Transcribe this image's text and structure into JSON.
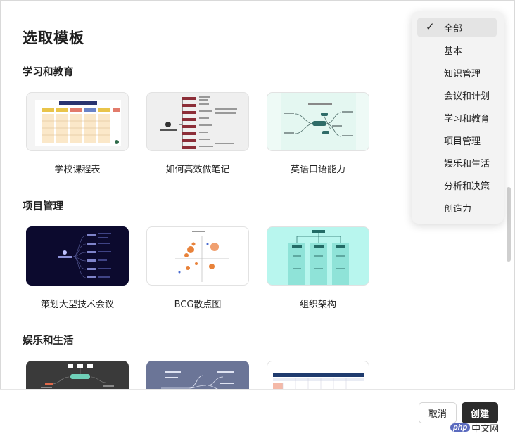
{
  "dialog": {
    "title": "选取模板"
  },
  "sections": [
    {
      "title": "学习和教育",
      "templates": [
        "学校课程表",
        "如何高效做笔记",
        "英语口语能力"
      ]
    },
    {
      "title": "项目管理",
      "templates": [
        "策划大型技术会议",
        "BCG散点图",
        "组织架构"
      ]
    },
    {
      "title": "娱乐和生活",
      "templates": [
        "",
        "",
        ""
      ]
    }
  ],
  "filter_menu": {
    "selected": "全部",
    "items": [
      "全部",
      "基本",
      "知识管理",
      "会议和计划",
      "学习和教育",
      "项目管理",
      "娱乐和生活",
      "分析和决策",
      "创造力"
    ]
  },
  "footer": {
    "cancel_label": "取消",
    "create_label": "创建"
  },
  "watermark": {
    "brand": "php",
    "text": "中文网"
  },
  "colors": {
    "create_button": "#2b2b2b",
    "menu_bg": "#f3f3f3",
    "accent_orange": "#e8823a"
  },
  "icons": {
    "check": "check-icon"
  }
}
